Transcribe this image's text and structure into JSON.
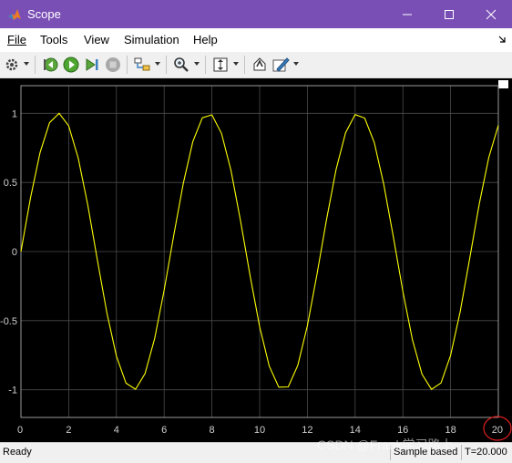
{
  "window": {
    "title": "Scope",
    "titlebar_color": "#7a4fb5",
    "controls": [
      "minimize-icon",
      "maximize-icon",
      "close-icon"
    ]
  },
  "menu": {
    "items": [
      {
        "label": "File"
      },
      {
        "label": "Tools"
      },
      {
        "label": "View"
      },
      {
        "label": "Simulation"
      },
      {
        "label": "Help"
      }
    ]
  },
  "toolbar": {
    "icons": [
      "gear-icon",
      "step-back-icon",
      "run-icon",
      "step-forward-icon",
      "stop-icon",
      "signal-select-icon",
      "zoom-icon",
      "autoscale-icon",
      "highlight-icon",
      "style-icon"
    ]
  },
  "status": {
    "ready": "Ready",
    "sample": "Sample based",
    "time": "T=20.000"
  },
  "watermark": "CSDN @Frank学习路上",
  "chart_data": {
    "type": "line",
    "series": [
      {
        "color": "#ffff00",
        "x": [
          0,
          0.4,
          0.8,
          1.2,
          1.6,
          2.0,
          2.4,
          2.8,
          3.2,
          3.6,
          4.0,
          4.4,
          4.8,
          5.2,
          5.6,
          6.0,
          6.4,
          6.8,
          7.2,
          7.6,
          8.0,
          8.4,
          8.8,
          9.2,
          9.6,
          10.0,
          10.4,
          10.8,
          11.2,
          11.6,
          12.0,
          12.4,
          12.8,
          13.2,
          13.6,
          14.0,
          14.4,
          14.8,
          15.2,
          15.6,
          16.0,
          16.4,
          16.8,
          17.2,
          17.6,
          18.0,
          18.4,
          18.8,
          19.2,
          19.6,
          20.0
        ],
        "y": [
          0,
          0.389,
          0.717,
          0.932,
          1.0,
          0.909,
          0.675,
          0.335,
          -0.058,
          -0.443,
          -0.757,
          -0.952,
          -0.996,
          -0.883,
          -0.631,
          -0.279,
          0.117,
          0.494,
          0.794,
          0.968,
          0.989,
          0.855,
          0.585,
          0.223,
          -0.174,
          -0.544,
          -0.828,
          -0.981,
          -0.979,
          -0.823,
          -0.537,
          -0.166,
          0.231,
          0.591,
          0.859,
          0.991,
          0.966,
          0.789,
          0.487,
          0.108,
          -0.288,
          -0.638,
          -0.887,
          -0.997,
          -0.951,
          -0.751,
          -0.436,
          -0.049,
          0.342,
          0.68,
          0.913
        ]
      }
    ],
    "xlim": [
      0,
      20
    ],
    "ylim": [
      -1.2,
      1.2
    ],
    "xticks": [
      "0",
      "2",
      "4",
      "6",
      "8",
      "10",
      "12",
      "14",
      "16",
      "18",
      "20"
    ],
    "yticks": [
      "1",
      "0.5",
      "0",
      "-0.5",
      "-1"
    ],
    "grid": true,
    "background": "#000000"
  }
}
